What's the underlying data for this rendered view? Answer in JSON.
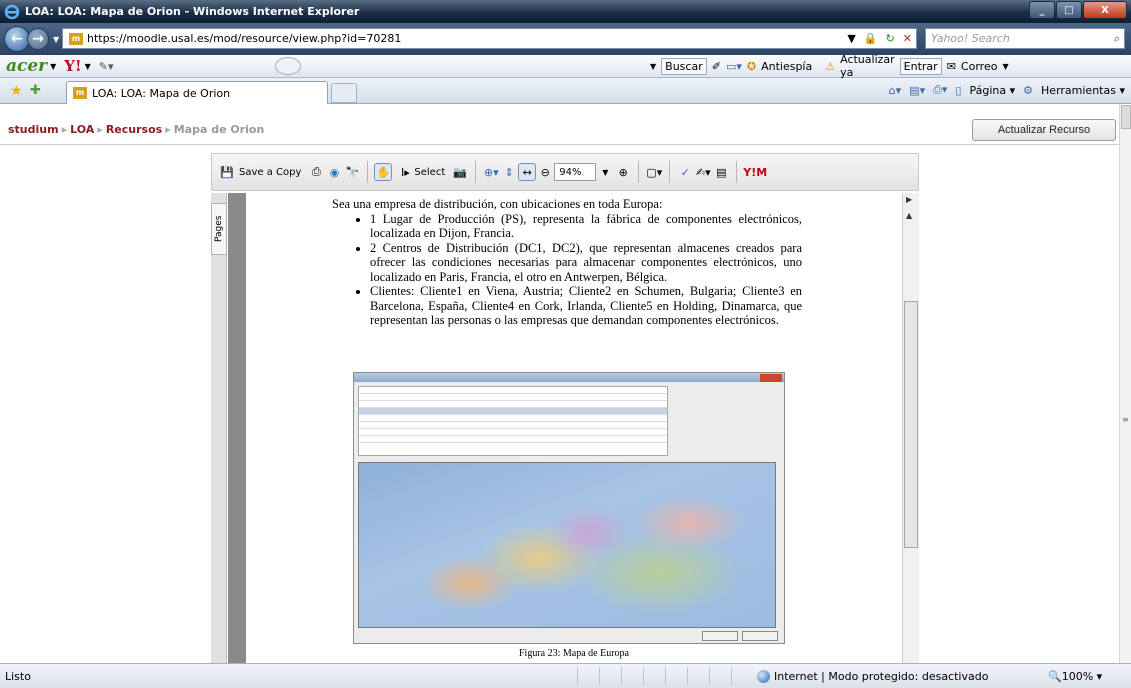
{
  "window": {
    "title": "LOA: LOA: Mapa de Orion - Windows Internet Explorer",
    "buttons": [
      "_",
      "□",
      "X"
    ]
  },
  "address": {
    "url": "https://moodle.usal.es/mod/resource/view.php?id=70281",
    "search_placeholder": "Yahoo! Search"
  },
  "toolbar": {
    "brand": "acer",
    "yahoo": "Y!",
    "buscar": "Buscar",
    "antiespia": "Antiespía",
    "actualizar": "Actualizar ya",
    "entrar": "Entrar",
    "correo": "Correo"
  },
  "tabs": {
    "active_label": "LOA: LOA: Mapa de Orion",
    "pagina": "Página",
    "herramientas": "Herramientas"
  },
  "moodle": {
    "breadcrumb": [
      "studium",
      "LOA",
      "Recursos",
      "Mapa de Orion"
    ],
    "update_button": "Actualizar Recurso"
  },
  "pdf_toolbar": {
    "save_copy": "Save a Copy",
    "select": "Select",
    "zoom": "94%",
    "pages_tab": "Pages"
  },
  "document": {
    "intro": "Sea una empresa de distribución, con ubicaciones en toda Europa:",
    "bullets": [
      "1 Lugar de Producción (PS), representa la fábrica de componentes electrónicos, localizada en Dijon, Francia.",
      "2 Centros de Distribución (DC1, DC2), que representan almacenes creados para ofrecer las condiciones necesarias para almacenar componentes electrónicos, uno localizado en Paris, Francia, el otro en Antwerpen, Bélgica.",
      "Clientes: Cliente1 en Viena, Austria; Cliente2 en Schumen, Bulgaria; Cliente3 en Barcelona, España, Cliente4 en Cork, Irlanda, Cliente5 en Holding, Dinamarca, que representan las personas o las empresas que demandan componentes electrónicos."
    ],
    "caption": "Figura 23: Mapa de Europa"
  },
  "status": {
    "left": "Listo",
    "zone": "Internet | Modo protegido: desactivado",
    "zoom": "100%"
  }
}
